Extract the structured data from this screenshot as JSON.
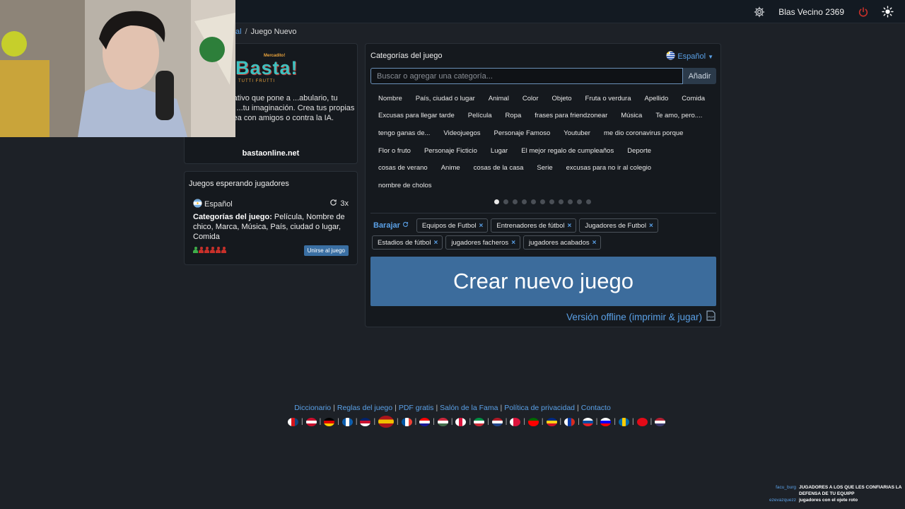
{
  "header": {
    "settings_icon": "gear-icon",
    "username": "Blas Vecino 2369",
    "power_icon": "power-icon",
    "theme_icon": "sun-icon",
    "accent": "#c8302a"
  },
  "breadcrumb": {
    "parent": "al",
    "current": "Juego Nuevo"
  },
  "intro": {
    "logo_top": "Mercadito!",
    "logo_main": "Basta!",
    "logo_sub": "TUTTI FRUTTI",
    "text": "...alabras creativo que pone a ...abulario, tu capacidad de ...tu imaginación. Crea tus propias ...uega en línea con amigos o contra la IA.",
    "site": "bastaonline.net"
  },
  "waiting": {
    "title": "Juegos esperando jugadores",
    "game": {
      "language": "Español",
      "rounds": "3x",
      "categories_label": "Categorías del juego:",
      "categories": "Película, Nombre de chico, Marca, Música, País, ciudad o lugar, Comida",
      "players_joined": 1,
      "players_total": 6,
      "join_label": "Unirse al juego"
    }
  },
  "main": {
    "title": "Categorías del juego",
    "language": "Español",
    "search_placeholder": "Buscar o agregar una categoría...",
    "add_label": "Añadir",
    "categories": [
      "Nombre",
      "País, ciudad o lugar",
      "Animal",
      "Color",
      "Objeto",
      "Fruta o verdura",
      "Apellido",
      "Comida",
      "Excusas para llegar tarde",
      "Película",
      "Ropa",
      "frases para friendzonear",
      "Música",
      "Te amo, pero....",
      "tengo ganas de...",
      "Videojuegos",
      "Personaje Famoso",
      "Youtuber",
      "me dio coronavirus porque",
      "Flor o fruto",
      "Personaje Ficticio",
      "Lugar",
      "El mejor regalo de cumpleaños",
      "Deporte",
      "cosas de verano",
      "Anime",
      "cosas de la casa",
      "Serie",
      "excusas para no ir al colegio",
      "nombre de cholos"
    ],
    "pages_total": 11,
    "page_current": 1,
    "shuffle_label": "Barajar",
    "selected": [
      "Equipos de Futbol",
      "Entrenadores de fútbol",
      "Jugadores de Futbol",
      "Estadios de fútbol",
      "jugadores facheros",
      "jugadores acabados"
    ],
    "create_label": "Crear nuevo juego",
    "offline_label": "Versión offline (imprimir & jugar)"
  },
  "footer": {
    "links": [
      "Diccionario",
      "Reglas del juego",
      "PDF gratis",
      "Salón de la Fama",
      "Política de privacidad",
      "Contacto"
    ]
  },
  "chat": [
    {
      "user": "facu_burg",
      "message": "JUGADORES A LOS QUE LES CONFIARIAS LA DEFENSA DE TU EQUIPP"
    },
    {
      "user": "ezevazquezz",
      "message": "jugadores con el ojete roto"
    }
  ]
}
